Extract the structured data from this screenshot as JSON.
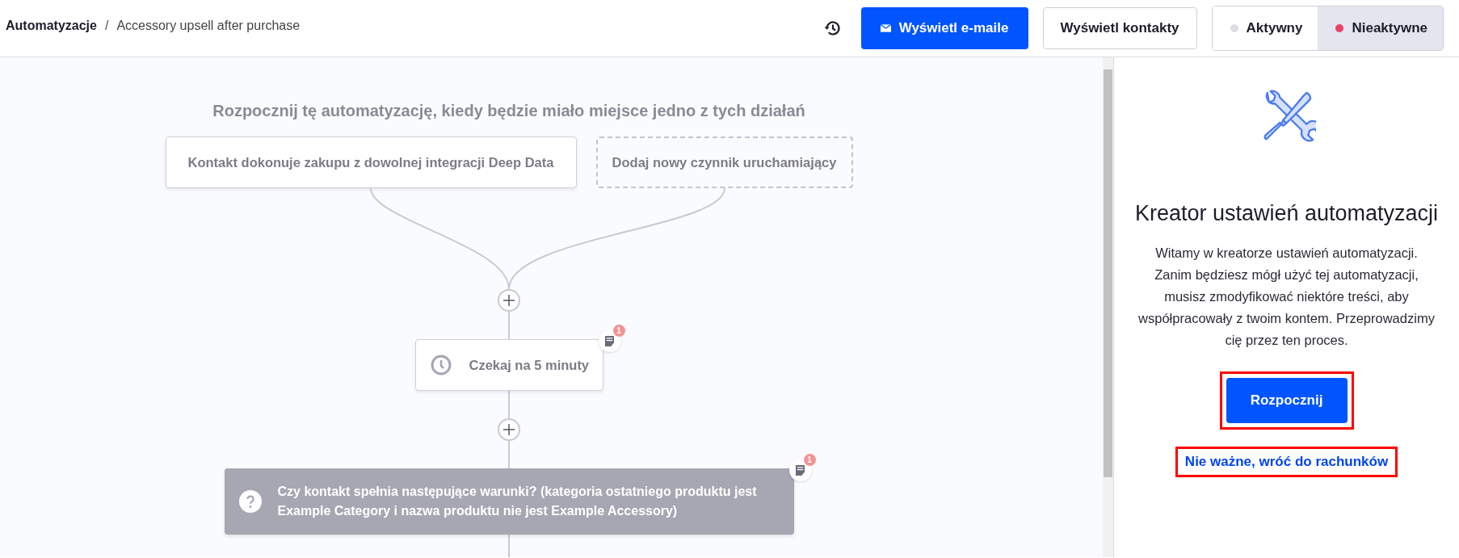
{
  "breadcrumb": {
    "section": "Automatyzacje",
    "separator": "/",
    "current": "Accessory upsell after purchase"
  },
  "header_buttons": [
    {
      "label": "Wyświetl e-maile",
      "kind": "primary"
    },
    {
      "label": "Wyświetl kontakty",
      "kind": "secondary"
    }
  ],
  "status_toggle": [
    {
      "label": "Aktywny",
      "selected": false,
      "color": "#dcdde6"
    },
    {
      "label": "Nieaktywne",
      "selected": true,
      "color": "#e8436a"
    }
  ],
  "canvas": {
    "heading": "Rozpocznij tę automatyzację, kiedy będzie miało miejsce jedno z tych działań",
    "triggers": [
      {
        "label": "Kontakt dokonuje zakupu z dowolnej integracji Deep Data",
        "kind": "trigger"
      },
      {
        "label": "Dodaj nowy czynnik uruchamiający",
        "kind": "add"
      }
    ],
    "steps": [
      {
        "kind": "wait",
        "label": "Czekaj na 5 minuty",
        "note_count": "1"
      },
      {
        "kind": "condition",
        "label": "Czy kontakt spełnia następujące warunki? (kategoria ostatniego produktu jest Example Category i nazwa produktu nie jest Example Accessory)",
        "note_count": "1"
      }
    ]
  },
  "sidebar": {
    "title": "Kreator ustawień automatyzacji",
    "text": "Witamy w kreatorze ustawień automatyzacji. Zanim będziesz mógł użyć tej automatyzacji, musisz zmodyfikować niektóre treści, aby współpracowały z twoim kontem. Przeprowadzimy cię przez ten proces.",
    "start_button": {
      "label": "Rozpocznij",
      "highlighted": true
    },
    "dismiss_link": {
      "label": "Nie ważne, wróć do rachunków",
      "highlighted": true
    }
  }
}
